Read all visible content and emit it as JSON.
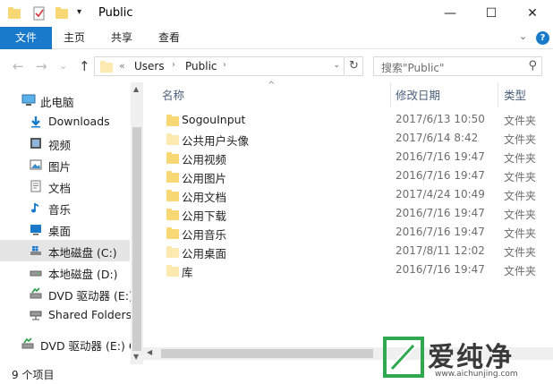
{
  "window": {
    "title": "Public",
    "minimize_label": "—",
    "maximize_label": "☐",
    "close_label": "✕",
    "qat_dropdown": "▾"
  },
  "ribbon": {
    "tabs": [
      "文件",
      "主页",
      "共享",
      "查看"
    ],
    "collapse_label": "⌄",
    "help_label": "?"
  },
  "address": {
    "back": "←",
    "forward": "→",
    "recent": "⌄",
    "up": "↑",
    "overflow": "«",
    "crumbs": [
      "Users",
      "Public"
    ],
    "sep": "›",
    "dropdown": "⌄",
    "refresh": "↻"
  },
  "search": {
    "placeholder": "搜索\"Public\"",
    "icon": "⚲"
  },
  "nav": {
    "items": [
      {
        "label": "此电脑",
        "icon": "computer-icon"
      },
      {
        "label": "Downloads",
        "icon": "download-arrow-icon"
      },
      {
        "label": "视频",
        "icon": "video-icon"
      },
      {
        "label": "图片",
        "icon": "pictures-icon"
      },
      {
        "label": "文档",
        "icon": "documents-icon"
      },
      {
        "label": "音乐",
        "icon": "music-note-icon"
      },
      {
        "label": "桌面",
        "icon": "desktop-icon"
      },
      {
        "label": "本地磁盘 (C:)",
        "icon": "windows-drive-icon",
        "selected": true
      },
      {
        "label": "本地磁盘 (D:)",
        "icon": "drive-icon"
      },
      {
        "label": "DVD 驱动器 (E:)",
        "icon": "dvd-drive-icon"
      },
      {
        "label": "Shared Folders",
        "icon": "network-drive-icon"
      },
      {
        "label": "DVD 驱动器 (E:) C",
        "icon": "dvd-drive-icon"
      }
    ]
  },
  "columns": {
    "name": "名称",
    "date": "修改日期",
    "type": "类型",
    "sort_indicator": "^"
  },
  "files": [
    {
      "name": "SogouInput",
      "date": "2017/6/13 10:50",
      "type": "文件夹",
      "icon": "folder-icon"
    },
    {
      "name": "公共用户头像",
      "date": "2017/6/14 8:42",
      "type": "文件夹",
      "icon": "folder-light-icon"
    },
    {
      "name": "公用视频",
      "date": "2016/7/16 19:47",
      "type": "文件夹",
      "icon": "folder-icon"
    },
    {
      "name": "公用图片",
      "date": "2016/7/16 19:47",
      "type": "文件夹",
      "icon": "folder-icon"
    },
    {
      "name": "公用文档",
      "date": "2017/4/24 10:49",
      "type": "文件夹",
      "icon": "folder-icon"
    },
    {
      "name": "公用下载",
      "date": "2016/7/16 19:47",
      "type": "文件夹",
      "icon": "folder-icon"
    },
    {
      "name": "公用音乐",
      "date": "2016/7/16 19:47",
      "type": "文件夹",
      "icon": "folder-icon"
    },
    {
      "name": "公用桌面",
      "date": "2017/8/11 12:02",
      "type": "文件夹",
      "icon": "folder-light-icon"
    },
    {
      "name": "库",
      "date": "2016/7/16 19:47",
      "type": "文件夹",
      "icon": "folder-light-icon"
    }
  ],
  "status": {
    "item_count": "9 个项目"
  },
  "watermark": {
    "text": "爱纯净",
    "url": "www.aichunjing.com"
  },
  "colors": {
    "accent": "#1979ca",
    "folder": "#f8d775",
    "selection": "#e5e5e5"
  }
}
